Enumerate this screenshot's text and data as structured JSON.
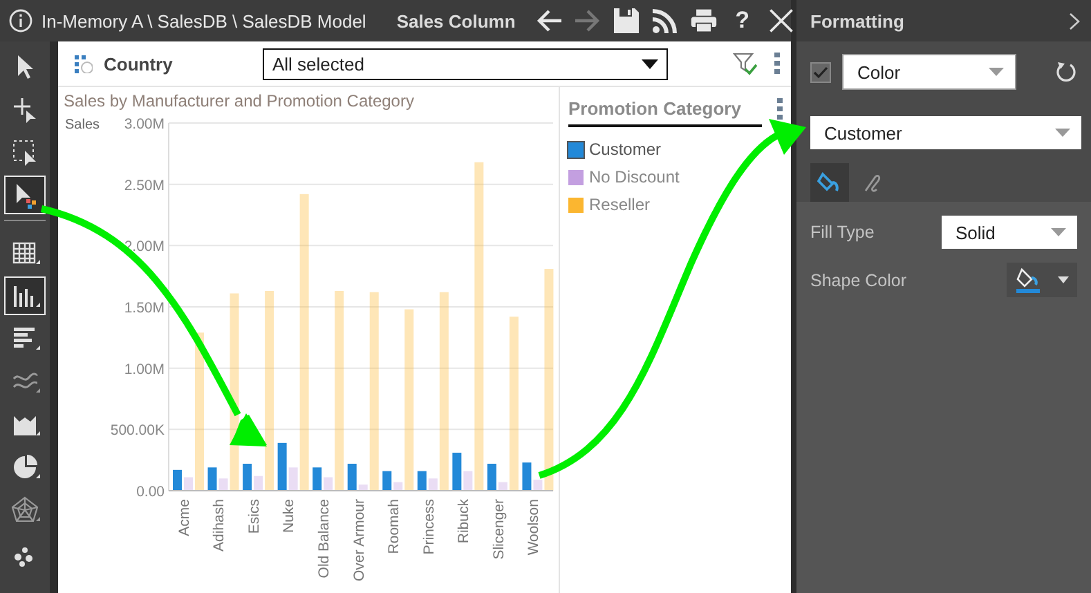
{
  "title_bar": {
    "path": "In-Memory A \\ SalesDB \\ SalesDB Model",
    "view_name": "Sales Column",
    "nav": [
      {
        "kind": "back",
        "disabled": false
      },
      {
        "kind": "forward",
        "disabled": true
      }
    ],
    "actions": [
      {
        "kind": "save"
      },
      {
        "kind": "rss"
      },
      {
        "kind": "print"
      },
      {
        "kind": "help",
        "label": "?"
      },
      {
        "kind": "close"
      }
    ]
  },
  "tools": [
    {
      "kind": "pointer",
      "selected": false
    },
    {
      "kind": "add-pointer",
      "selected": false
    },
    {
      "kind": "marquee",
      "selected": false
    },
    {
      "kind": "color-select",
      "selected": true
    }
  ],
  "chart_types": [
    {
      "kind": "table",
      "selected": false
    },
    {
      "kind": "column",
      "selected": true
    },
    {
      "kind": "bar",
      "selected": false
    },
    {
      "kind": "line",
      "selected": false
    },
    {
      "kind": "area",
      "selected": false
    },
    {
      "kind": "pie",
      "selected": false
    },
    {
      "kind": "radar",
      "selected": false
    },
    {
      "kind": "scatter",
      "selected": false
    }
  ],
  "filter": {
    "label": "Country",
    "value": "All selected"
  },
  "chart": {
    "chart_data": {
      "type": "bar",
      "title": "Sales by Manufacturer and Promotion Category",
      "ylabel": "Sales",
      "categories": [
        "Acme",
        "Adihash",
        "Esics",
        "Nuke",
        "Old Balance",
        "Over Armour",
        "Roomah",
        "Princess",
        "Ribuck",
        "Slicenger",
        "Woolson"
      ],
      "series": [
        {
          "name": "Customer",
          "color": "#2389d8",
          "values": [
            170000,
            190000,
            220000,
            390000,
            190000,
            220000,
            160000,
            160000,
            310000,
            220000,
            230000
          ]
        },
        {
          "name": "No Discount",
          "color": "#c39fe0",
          "values": [
            110000,
            100000,
            120000,
            190000,
            110000,
            50000,
            70000,
            100000,
            160000,
            70000,
            90000
          ]
        },
        {
          "name": "Reseller",
          "color": "#fbb630",
          "values": [
            1290000,
            1610000,
            1630000,
            2420000,
            1630000,
            1620000,
            1480000,
            1620000,
            2680000,
            1420000,
            1810000
          ]
        }
      ],
      "grid": true,
      "ylim": [
        0,
        3000000
      ],
      "yticks": [
        {
          "value": 0,
          "label": "0.00"
        },
        {
          "value": 500000,
          "label": "500.00K"
        },
        {
          "value": 1000000,
          "label": "1.00M"
        },
        {
          "value": 1500000,
          "label": "1.50M"
        },
        {
          "value": 2000000,
          "label": "2.00M"
        },
        {
          "value": 2500000,
          "label": "2.50M"
        },
        {
          "value": 3000000,
          "label": "3.00M"
        }
      ]
    }
  },
  "legend": {
    "title": "Promotion Category",
    "items": [
      {
        "selected": true
      },
      {
        "selected": false
      },
      {
        "selected": false
      }
    ]
  },
  "formatting": {
    "title": "Formatting",
    "property": {
      "checked": true,
      "value": "Color"
    },
    "series": "Customer",
    "tabs": [
      {
        "kind": "fill",
        "selected": true
      },
      {
        "kind": "line",
        "selected": false
      }
    ],
    "fill_type": {
      "label": "Fill Type",
      "value": "Solid"
    },
    "shape_color": {
      "label": "Shape Color",
      "color": "#2389d8"
    }
  }
}
